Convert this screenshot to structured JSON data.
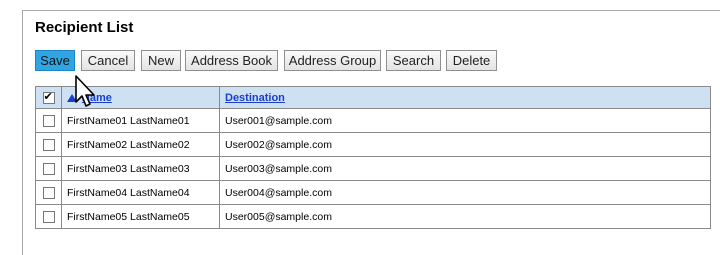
{
  "page": {
    "title": "Recipient List"
  },
  "toolbar": {
    "save": "Save",
    "cancel": "Cancel",
    "new": "New",
    "address_book": "Address Book",
    "address_group": "Address Group",
    "search": "Search",
    "delete": "Delete"
  },
  "table": {
    "headers": {
      "name": "Name",
      "destination": "Destination"
    },
    "select_all_checked": true,
    "rows": [
      {
        "name": "FirstName01 LastName01",
        "destination": "User001@sample.com"
      },
      {
        "name": "FirstName02 LastName02",
        "destination": "User002@sample.com"
      },
      {
        "name": "FirstName03 LastName03",
        "destination": "User003@sample.com"
      },
      {
        "name": "FirstName04 LastName04",
        "destination": "User004@sample.com"
      },
      {
        "name": "FirstName05 LastName05",
        "destination": "User005@sample.com"
      }
    ]
  },
  "colors": {
    "primary_button": "#2fa6e3",
    "header_bg": "#cde1f3",
    "link": "#1a3fcc"
  },
  "icons": {
    "cursor": "pointer-arrow-icon",
    "sort": "sort-ascending-icon"
  }
}
